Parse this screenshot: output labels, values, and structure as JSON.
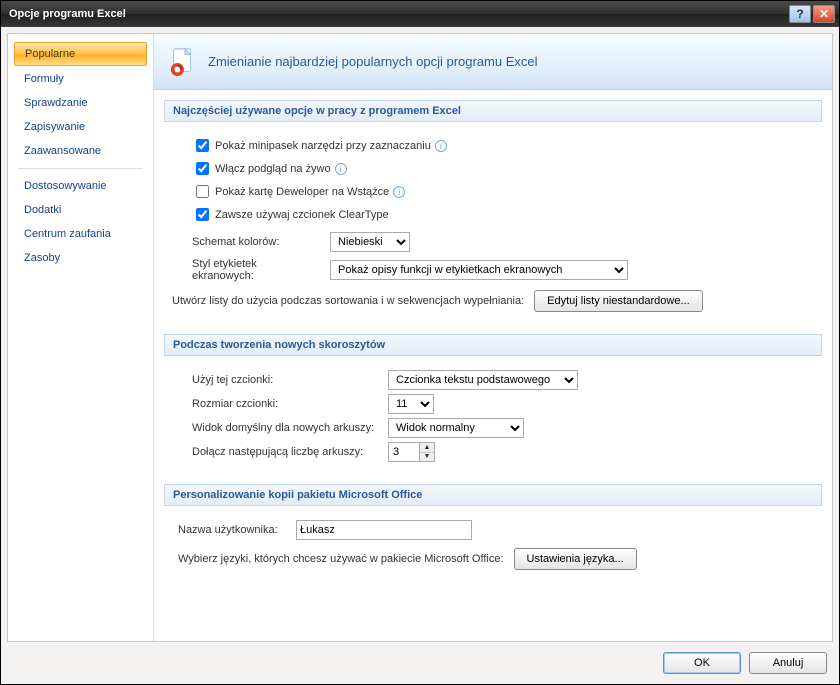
{
  "window": {
    "title": "Opcje programu Excel"
  },
  "titlebar": {
    "help_symbol": "?",
    "close_symbol": "✕"
  },
  "sidebar": {
    "items": [
      {
        "label": "Popularne"
      },
      {
        "label": "Formuły"
      },
      {
        "label": "Sprawdzanie"
      },
      {
        "label": "Zapisywanie"
      },
      {
        "label": "Zaawansowane"
      },
      {
        "label": "Dostosowywanie"
      },
      {
        "label": "Dodatki"
      },
      {
        "label": "Centrum zaufania"
      },
      {
        "label": "Zasoby"
      }
    ]
  },
  "header": {
    "text": "Zmienianie najbardziej popularnych opcji programu Excel"
  },
  "sections": {
    "top": {
      "title": "Najczęściej używane opcje w pracy z programem Excel",
      "chk_minitoolbar": "Pokaż minipasek narzędzi przy zaznaczaniu",
      "chk_livepreview": "Włącz podgląd na żywo",
      "chk_developer": "Pokaż kartę Deweloper na Wstążce",
      "chk_cleartype": "Zawsze używaj czcionek ClearType",
      "colorscheme_label": "Schemat kolorów:",
      "colorscheme_value": "Niebieski",
      "screentip_label": "Styl etykietek ekranowych:",
      "screentip_value": "Pokaż opisy funkcji w etykietkach ekranowych",
      "customlists_text": "Utwórz listy do użycia podczas sortowania i w sekwencjach wypełniania:",
      "customlists_btn": "Edytuj listy niestandardowe..."
    },
    "wb": {
      "title": "Podczas tworzenia nowych skoroszytów",
      "font_label": "Użyj tej czcionki:",
      "font_value": "Czcionka tekstu podstawowego",
      "fontsize_label": "Rozmiar czcionki:",
      "fontsize_value": "11",
      "view_label": "Widok domyślny dla nowych arkuszy:",
      "view_value": "Widok normalny",
      "sheets_label": "Dołącz następującą liczbę arkuszy:",
      "sheets_value": "3"
    },
    "personal": {
      "title": "Personalizowanie kopii pakietu Microsoft Office",
      "username_label": "Nazwa użytkownika:",
      "username_value": "Łukasz",
      "lang_text": "Wybierz języki, których chcesz używać w pakiecie Microsoft Office:",
      "lang_btn": "Ustawienia języka..."
    }
  },
  "footer": {
    "ok": "OK",
    "cancel": "Anuluj"
  }
}
